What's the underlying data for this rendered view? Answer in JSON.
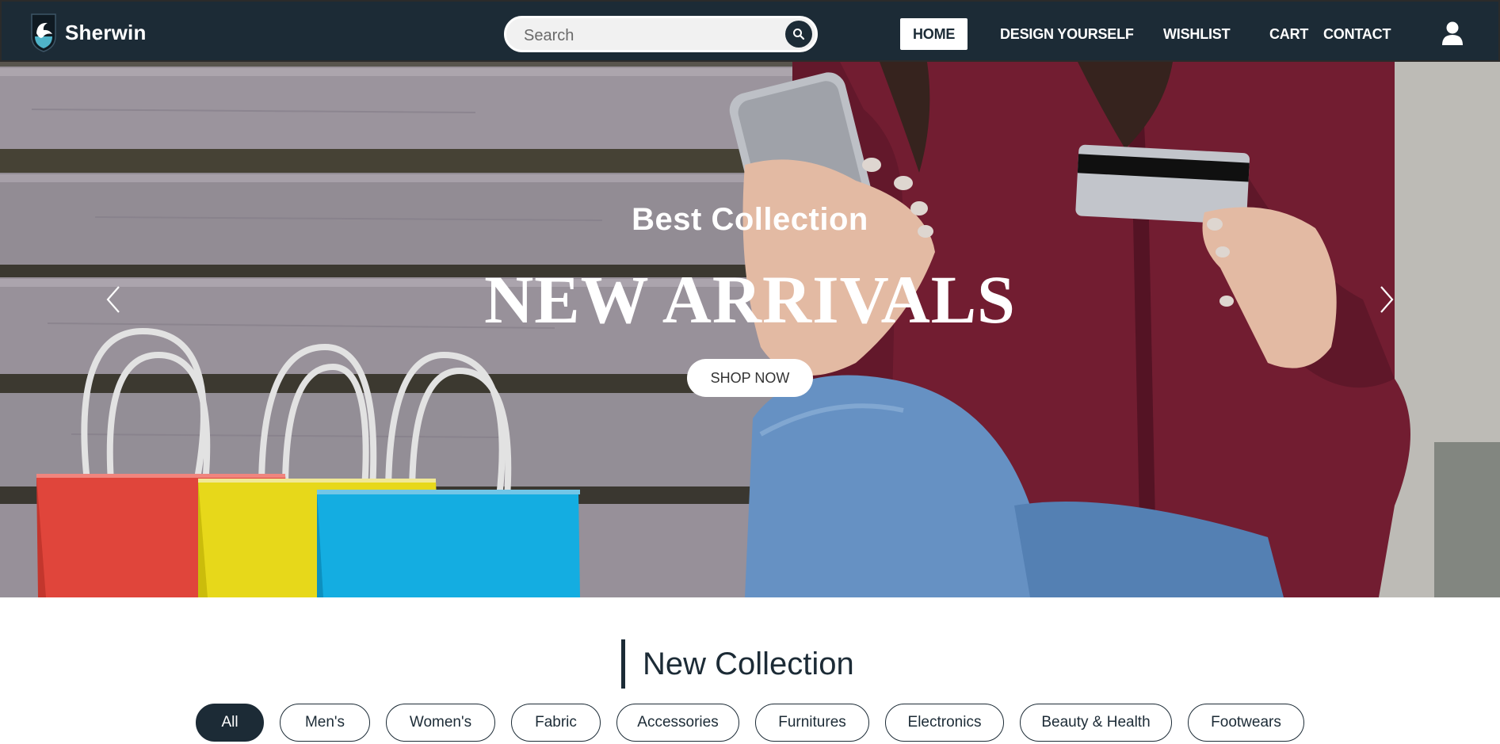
{
  "brand": {
    "name": "Sherwin",
    "logo_icon": "shield-bird-logo"
  },
  "search": {
    "placeholder": "Search",
    "value": "",
    "button_icon": "search-icon"
  },
  "nav": {
    "items": [
      {
        "label": "HOME",
        "active": true
      },
      {
        "label": "DESIGN YOURSELF",
        "active": false
      },
      {
        "label": "WISHLIST",
        "active": false
      },
      {
        "label": "CART",
        "active": false
      },
      {
        "label": "CONTACT",
        "active": false
      }
    ],
    "user_icon": "user-icon"
  },
  "hero": {
    "subtitle": "Best Collection",
    "title": "NEW ARRIVALS",
    "cta_label": "SHOP NOW",
    "prev_icon": "chevron-left-icon",
    "next_icon": "chevron-right-icon"
  },
  "collection": {
    "title": "New Collection",
    "filters": [
      {
        "label": "All",
        "active": true
      },
      {
        "label": "Men's",
        "active": false
      },
      {
        "label": "Women's",
        "active": false
      },
      {
        "label": "Fabric",
        "active": false
      },
      {
        "label": "Accessories",
        "active": false
      },
      {
        "label": "Furnitures",
        "active": false
      },
      {
        "label": "Electronics",
        "active": false
      },
      {
        "label": "Beauty & Health",
        "active": false
      },
      {
        "label": "Footwears",
        "active": false
      }
    ]
  },
  "colors": {
    "primary": "#1c2b36",
    "white": "#ffffff",
    "bag_red": "#ef4a3f",
    "bag_yellow": "#f6e61c",
    "bag_blue": "#16b8f0",
    "shirt": "#7a1f35"
  }
}
